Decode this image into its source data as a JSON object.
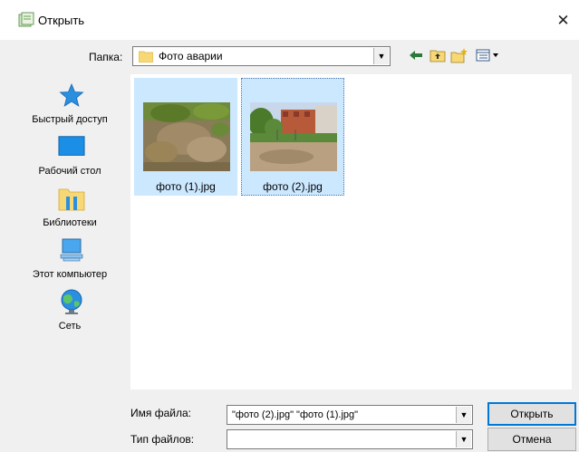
{
  "window": {
    "title": "Открыть",
    "close": "✕"
  },
  "toolbar": {
    "folder_label": "Папка:",
    "folder_value": "Фото аварии"
  },
  "places": [
    {
      "icon": "star-icon",
      "label": "Быстрый доступ"
    },
    {
      "icon": "desktop-icon",
      "label": "Рабочий стол"
    },
    {
      "icon": "libraries-icon",
      "label": "Библиотеки"
    },
    {
      "icon": "computer-icon",
      "label": "Этот компьютер"
    },
    {
      "icon": "network-globe-icon",
      "label": "Сеть"
    }
  ],
  "files": [
    {
      "name": "фото (1).jpg"
    },
    {
      "name": "фото (2).jpg"
    }
  ],
  "form": {
    "filename_label": "Имя файла:",
    "filename_value": "\"фото (2).jpg\" \"фото (1).jpg\"",
    "filetype_label": "Тип файлов:",
    "filetype_value": "",
    "open_button": "Открыть",
    "cancel_button": "Отмена"
  }
}
